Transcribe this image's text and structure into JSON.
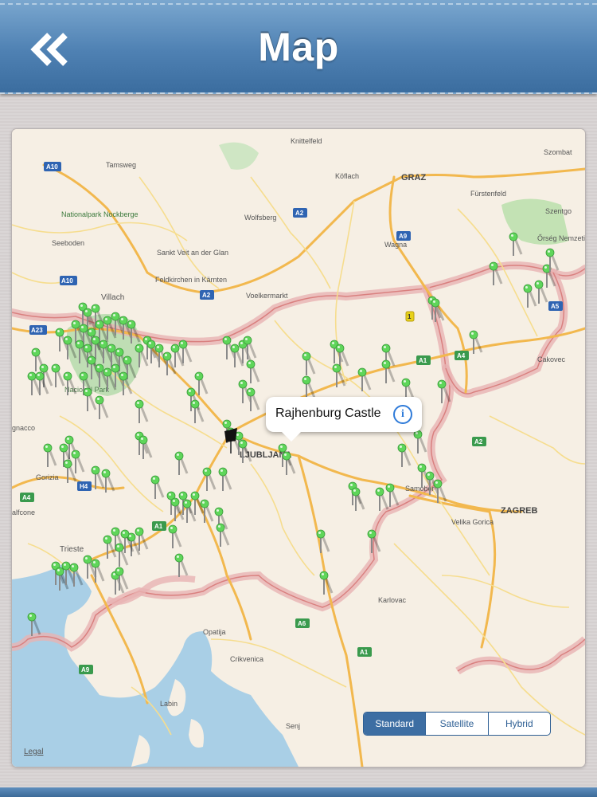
{
  "header": {
    "title": "Map",
    "back_icon": "double-chevron-left-icon",
    "background_color": "#4f81b3"
  },
  "map": {
    "callout": {
      "title": "Rajhenburg Castle",
      "info_icon": "info-icon"
    },
    "place_labels": [
      "Knittelfeld",
      "Szombat",
      "Tamsweg",
      "Köflach",
      "GRAZ",
      "Fürstenfeld",
      "Nationalpark Nockberge",
      "Szentgo",
      "Seeboden",
      "Wolfsberg",
      "Sankt Veit an der Glan",
      "Wagna",
      "Őrség Nemzeti P",
      "Feldkirchen in Kärnten",
      "Villach",
      "Voelkermarkt",
      "Cakovec",
      "Nacional Park",
      "gnacco",
      "LJUBLJANA",
      "Gorizia",
      "Samobor",
      "ZAGREB",
      "alfcone",
      "Trieste",
      "Velika Gorica",
      "Karlovac",
      "Opatija",
      "Crikvenica",
      "Labin",
      "Senj"
    ],
    "road_labels": [
      "A10",
      "A2",
      "A9",
      "A23",
      "A10",
      "A2",
      "A5",
      "A1",
      "A4",
      "A2",
      "H4",
      "A4",
      "A1",
      "A6",
      "A1",
      "A9",
      "1"
    ],
    "pin_color": "#5fd65a",
    "selected_pin_color": "#111111",
    "border_color": "#e6a6a6"
  },
  "map_type": {
    "options": [
      "Standard",
      "Satellite",
      "Hybrid"
    ],
    "selected": "Standard"
  },
  "legal_label": "Legal"
}
